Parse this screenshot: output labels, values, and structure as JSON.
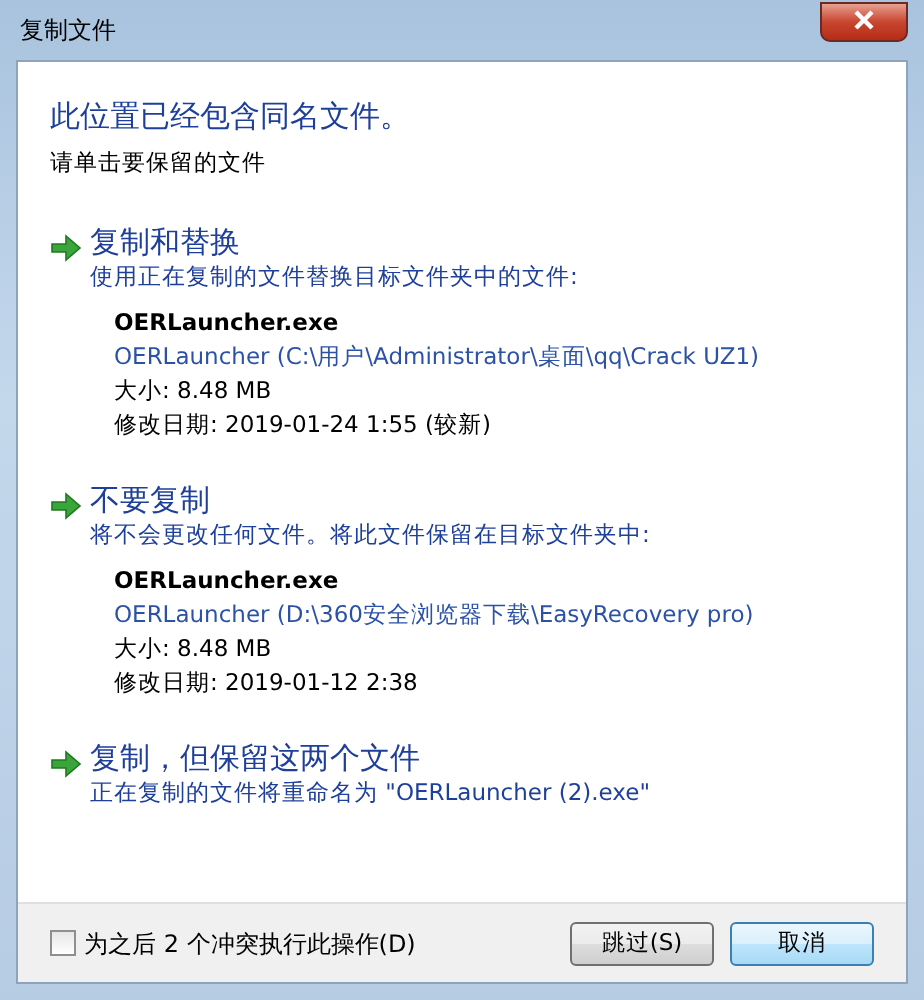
{
  "window": {
    "title": "复制文件"
  },
  "heading": "此位置已经包含同名文件。",
  "subheading": "请单击要保留的文件",
  "options": [
    {
      "title": "复制和替换",
      "description": "使用正在复制的文件替换目标文件夹中的文件:",
      "file": {
        "name": "OERLauncher.exe",
        "path": "OERLauncher (C:\\用户\\Administrator\\桌面\\qq\\Crack UZ1)",
        "size": "大小: 8.48 MB",
        "modified": "修改日期: 2019-01-24  1:55 (较新)"
      }
    },
    {
      "title": "不要复制",
      "description": "将不会更改任何文件。将此文件保留在目标文件夹中:",
      "file": {
        "name": "OERLauncher.exe",
        "path": "OERLauncher (D:\\360安全浏览器下载\\EasyRecovery pro)",
        "size": "大小: 8.48 MB",
        "modified": "修改日期: 2019-01-12  2:38"
      }
    },
    {
      "title": "复制，但保留这两个文件",
      "description": "正在复制的文件将重命名为 \"OERLauncher (2).exe\""
    }
  ],
  "apply_all": {
    "label": "为之后 2 个冲突执行此操作(D)",
    "checked": false
  },
  "buttons": [
    {
      "label": "跳过(S)",
      "selected": false
    },
    {
      "label": "取消",
      "selected": true
    }
  ]
}
